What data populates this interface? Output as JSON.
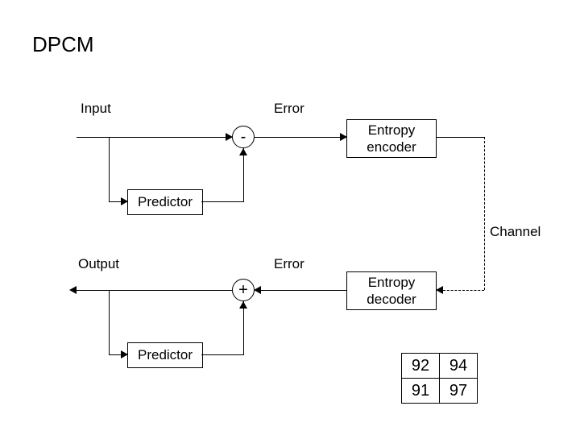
{
  "title": "DPCM",
  "encoder": {
    "input_label": "Input",
    "error_label": "Error",
    "sum_symbol": "-",
    "block_label": "Entropy\nencoder",
    "predictor_label": "Predictor"
  },
  "channel_label": "Channel",
  "decoder": {
    "output_label": "Output",
    "error_label": "Error",
    "sum_symbol": "+",
    "block_label": "Entropy\ndecoder",
    "predictor_label": "Predictor"
  },
  "sample_table": {
    "rows": [
      [
        "92",
        "94"
      ],
      [
        "91",
        "97"
      ]
    ]
  }
}
